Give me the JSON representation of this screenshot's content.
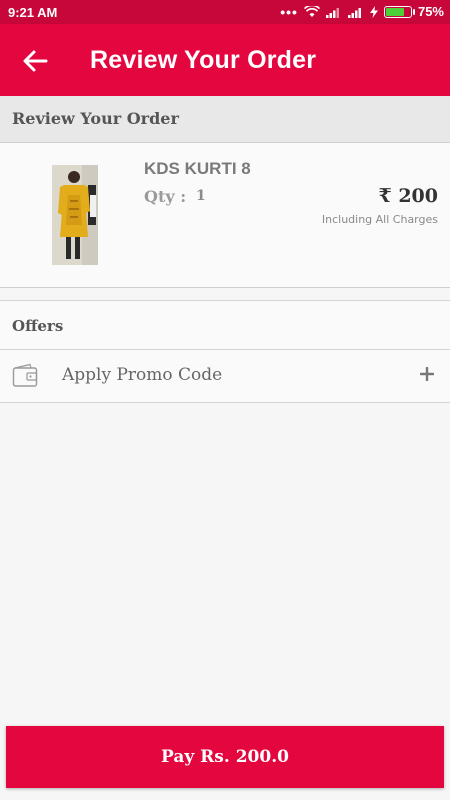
{
  "status_bar": {
    "time": "9:21 AM",
    "battery_level": "75%",
    "icons": [
      "dots-icon",
      "wifi-icon",
      "signal-icon",
      "signal-icon",
      "charging-icon",
      "battery-icon"
    ]
  },
  "app_bar": {
    "title": "Review Your Order",
    "back_icon": "arrow-left-icon",
    "color": "#e4063f"
  },
  "section_header": {
    "title": "Review Your Order"
  },
  "order_item": {
    "name": "KDS KURTI 8",
    "qty_label": "Qty :",
    "qty_value": "1",
    "price": "₹ 200",
    "charges_note": "Including All Charges"
  },
  "offers": {
    "title": "Offers",
    "promo_label": "Apply Promo Code",
    "promo_icon": "wallet-icon",
    "add_icon": "plus-icon"
  },
  "footer": {
    "pay_label": "Pay Rs. 200.0"
  }
}
